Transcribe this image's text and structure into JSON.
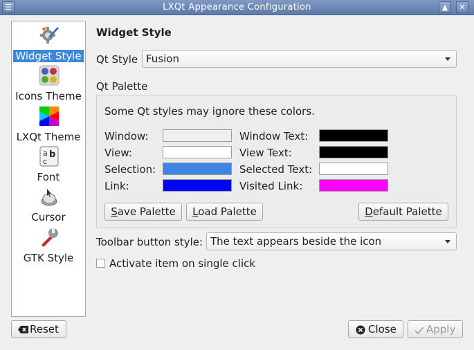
{
  "window": {
    "title": "LXQt Appearance Configuration"
  },
  "sidebar": {
    "items": [
      {
        "label": "Widget Style",
        "icon": "widget-style-icon",
        "selected": true
      },
      {
        "label": "Icons Theme",
        "icon": "icons-theme-icon"
      },
      {
        "label": "LXQt Theme",
        "icon": "lxqt-theme-icon"
      },
      {
        "label": "Font",
        "icon": "font-icon"
      },
      {
        "label": "Cursor",
        "icon": "cursor-icon"
      },
      {
        "label": "GTK Style",
        "icon": "gtk-style-icon"
      }
    ]
  },
  "main": {
    "heading": "Widget Style",
    "qt_style_label": "Qt Style",
    "qt_style_value": "Fusion",
    "palette_label": "Qt Palette",
    "palette_note": "Some Qt styles may ignore these colors.",
    "colors": {
      "window_label": "Window:",
      "window_color": "#efefef",
      "view_label": "View:",
      "view_color": "#ffffff",
      "selection_label": "Selection:",
      "selection_color": "#3d86e6",
      "link_label": "Link:",
      "link_color": "#0000ff",
      "window_text_label": "Window Text:",
      "window_text_color": "#000000",
      "view_text_label": "View Text:",
      "view_text_color": "#000000",
      "selected_text_label": "Selected Text:",
      "selected_text_color": "#ffffff",
      "visited_link_label": "Visited Link:",
      "visited_link_color": "#ff00ff"
    },
    "save_palette": {
      "first": "S",
      "rest": "ave Palette"
    },
    "load_palette": {
      "first": "L",
      "rest": "oad Palette"
    },
    "default_palette": {
      "first": "D",
      "rest": "efault Palette"
    },
    "toolbar_style_label": "Toolbar button style:",
    "toolbar_style_value": "The text appears beside the icon",
    "single_click_label": "Activate item on single click"
  },
  "footer": {
    "reset_label": "Reset",
    "close_label": "Close",
    "apply_label": "Apply"
  }
}
